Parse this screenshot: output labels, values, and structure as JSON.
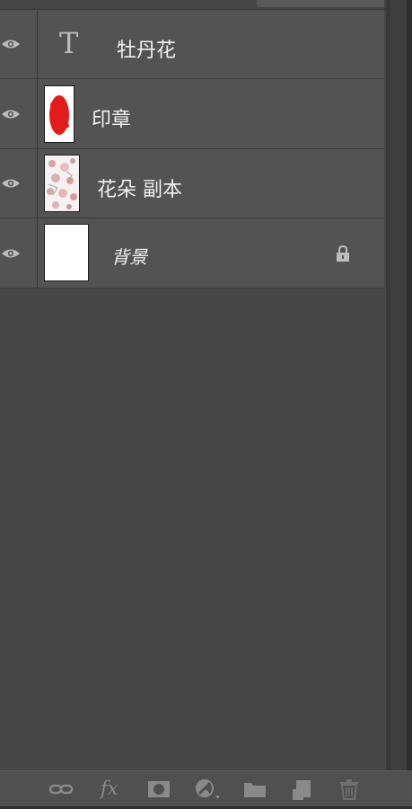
{
  "layers_panel": {
    "layers": [
      {
        "name": "牡丹花",
        "kind": "text",
        "visibility_icon": "eye-icon"
      },
      {
        "name": "印章",
        "kind": "raster",
        "visibility_icon": "eye-icon",
        "thumbnail_color": "#e31b1b"
      },
      {
        "name": "花朵 副本",
        "kind": "raster",
        "visibility_icon": "eye-icon"
      },
      {
        "name": "背景",
        "kind": "background",
        "visibility_icon": "eye-icon",
        "locked": true,
        "thumbnail_color": "#ffffff"
      }
    ],
    "text_layer_glyph": "T",
    "footer_tools": [
      {
        "icon": "link-layers-icon"
      },
      {
        "icon": "fx-icon",
        "label": "fx"
      },
      {
        "icon": "add-mask-icon"
      },
      {
        "icon": "adjustment-layer-icon"
      },
      {
        "icon": "new-group-icon"
      },
      {
        "icon": "new-layer-icon"
      },
      {
        "icon": "trash-icon"
      }
    ]
  },
  "colors": {
    "panel_bg": "#474747",
    "row_bg": "#535353",
    "text": "#f0f0f0",
    "icon": "#b8b8b8",
    "seal_red": "#e31b1b"
  }
}
